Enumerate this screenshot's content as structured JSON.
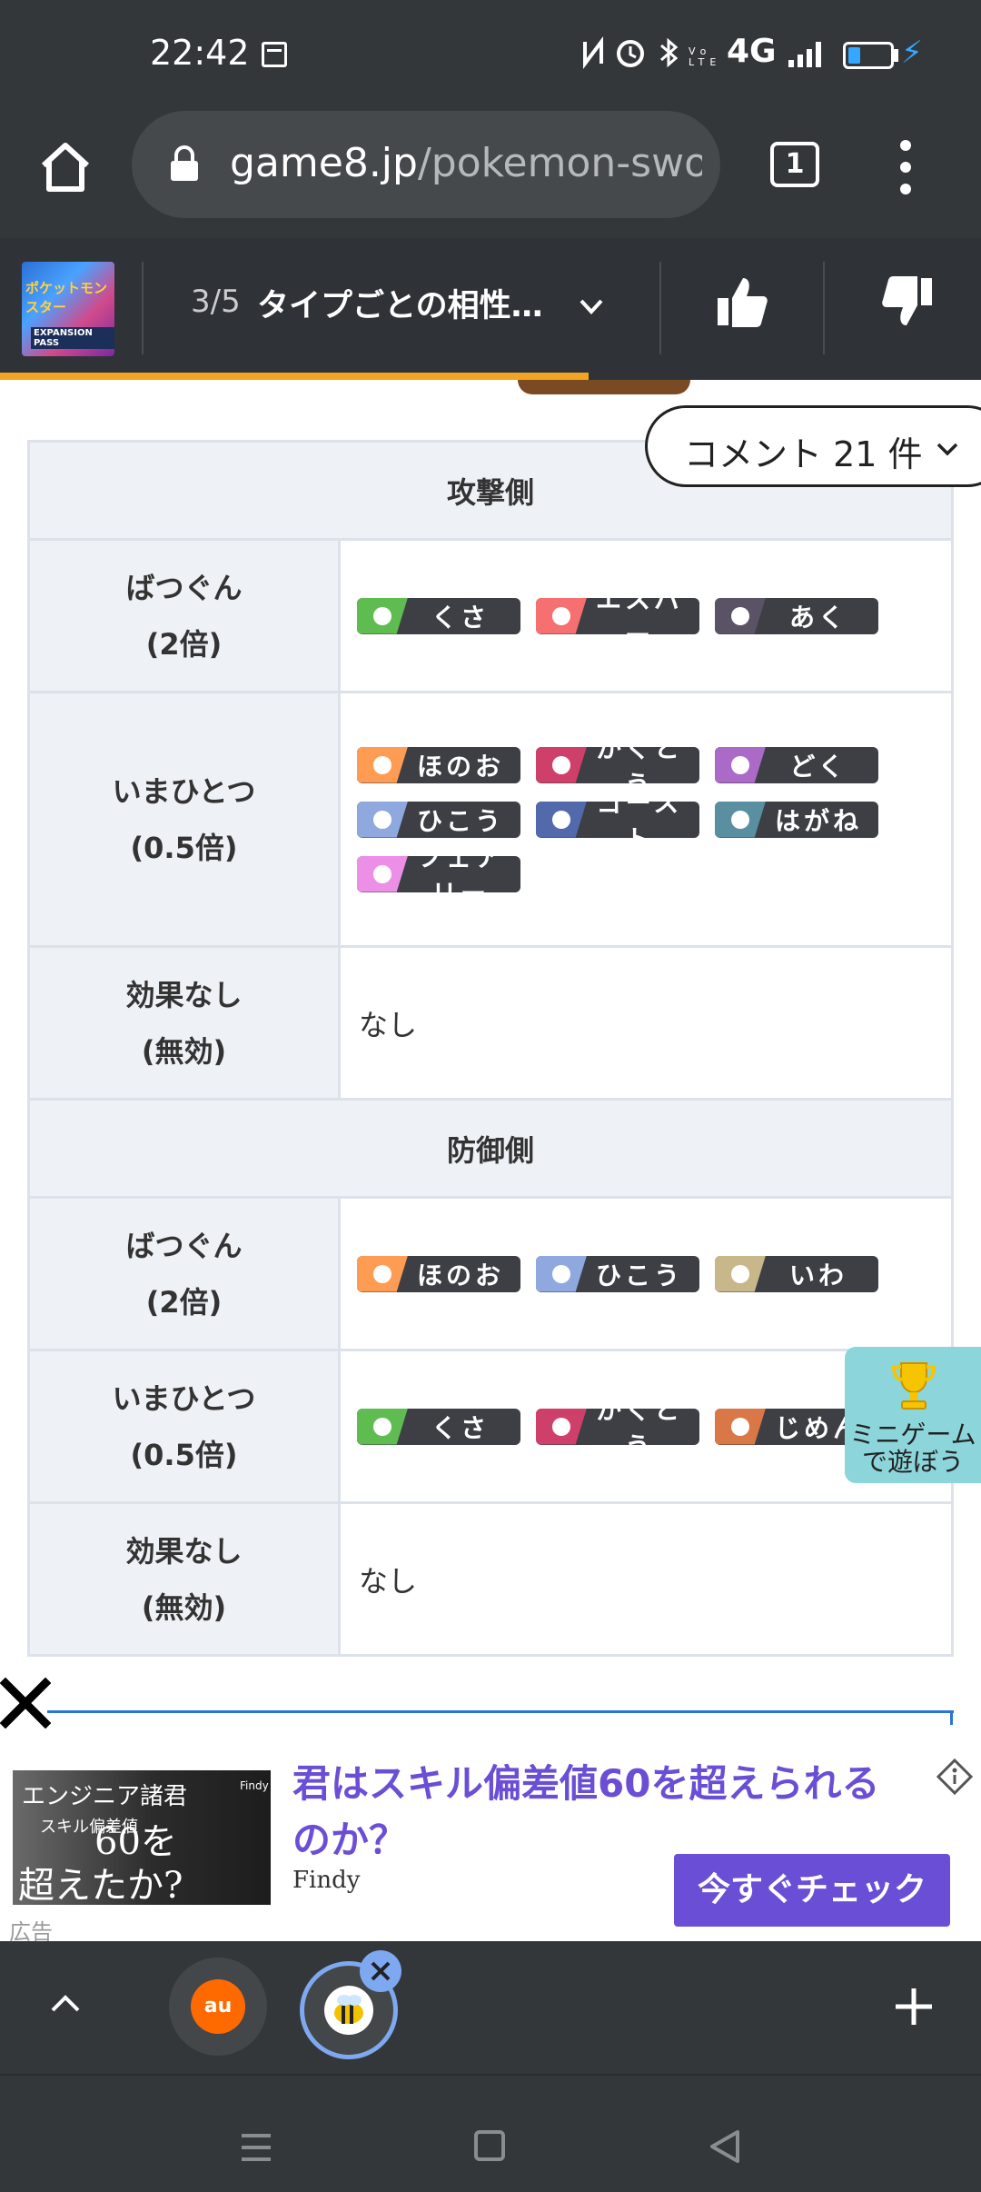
{
  "status_bar": {
    "time": "22:42",
    "network": "4G",
    "battery_level": 0.3
  },
  "browser": {
    "url_host": "game8.jp",
    "url_path": "/pokemon-swo",
    "tab_count": "1"
  },
  "article_bar": {
    "thumb_text_1": "ポケットモンスター",
    "thumb_text_2": "EXPANSION PASS",
    "page": "3/5",
    "title": "タイプごとの相性…",
    "reading_progress": 0.6
  },
  "comment_pill": {
    "label": "コメント 21 件"
  },
  "table": {
    "attack_header": "攻撃側",
    "defense_header": "防御側",
    "attack_rows": [
      {
        "label_1": "ばつぐん",
        "label_2": "(2倍)",
        "types": [
          "くさ",
          "エスパー",
          "あく"
        ]
      },
      {
        "label_1": "いまひとつ",
        "label_2": "(0.5倍)",
        "types": [
          "ほのお",
          "かくとう",
          "どく",
          "ひこう",
          "ゴースト",
          "はがね",
          "フェアリー"
        ]
      },
      {
        "label_1": "効果なし",
        "label_2": "(無効)",
        "text": "なし"
      }
    ],
    "defense_rows": [
      {
        "label_1": "ばつぐん",
        "label_2": "(2倍)",
        "types": [
          "ほのお",
          "ひこう",
          "いわ"
        ]
      },
      {
        "label_1": "いまひとつ",
        "label_2": "(0.5倍)",
        "types": [
          "くさ",
          "かくとう",
          "じめん"
        ]
      },
      {
        "label_1": "効果なし",
        "label_2": "(無効)",
        "text": "なし"
      }
    ],
    "type_colors": {
      "くさ": "#5fbc51",
      "エスパー": "#f66f71",
      "あく": "#5a5366",
      "ほのお": "#ff9c54",
      "かくとう": "#ce4069",
      "どく": "#ab6ac8",
      "ひこう": "#8fa8dd",
      "ゴースト": "#5269ac",
      "はがね": "#5a8ea1",
      "フェアリー": "#ec8fe6",
      "いわ": "#c7b78b",
      "じめん": "#d97746"
    },
    "type_icons": {
      "くさ": "leaf-icon",
      "エスパー": "swirl-icon",
      "あく": "moon-icon",
      "ほのお": "flame-icon",
      "かくとう": "fist-icon",
      "どく": "skull-icon",
      "ひこう": "wing-icon",
      "ゴースト": "ghost-icon",
      "はがね": "gear-icon",
      "フェアリー": "star-icon",
      "いわ": "rock-icon",
      "じめん": "mountain-icon"
    }
  },
  "mini_game": {
    "line_1": "ミニゲーム",
    "line_2": "で遊ぼう"
  },
  "ad": {
    "image_text_1": "エンジニア諸君",
    "image_text_2": "スキル偏差値",
    "image_text_3": "60を",
    "image_text_4": "超えたか?",
    "image_brand": "Findy",
    "headline": "君はスキル偏差値60を超えられるのか？",
    "advertiser": "Findy",
    "cta": "今すぐチェック",
    "label": "広告"
  },
  "tab_strip": {
    "tab_1_label": "au"
  }
}
